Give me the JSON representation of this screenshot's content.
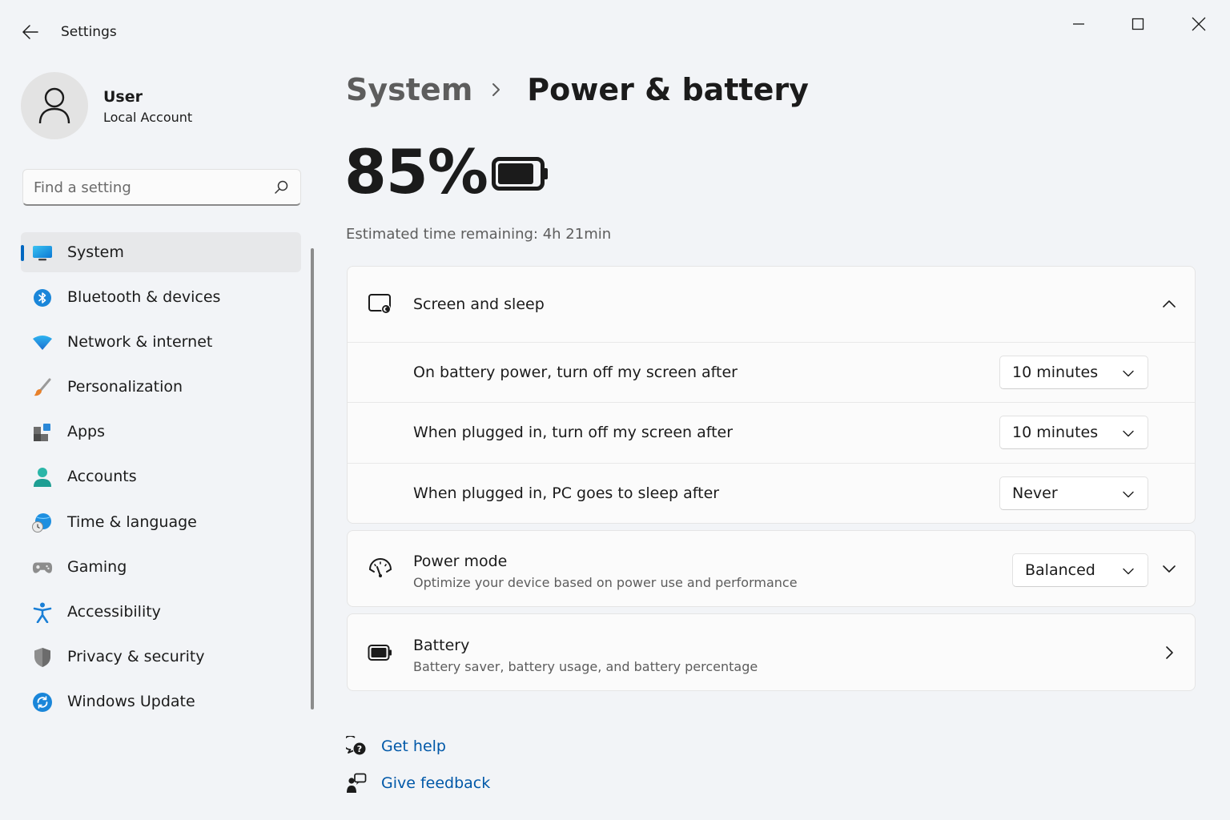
{
  "window": {
    "title": "Settings"
  },
  "user": {
    "name": "User",
    "account_type": "Local Account"
  },
  "search": {
    "placeholder": "Find a setting"
  },
  "sidebar": {
    "items": [
      {
        "label": "System",
        "icon": "system-display-icon",
        "active": true
      },
      {
        "label": "Bluetooth & devices",
        "icon": "bluetooth-icon"
      },
      {
        "label": "Network & internet",
        "icon": "wifi-icon"
      },
      {
        "label": "Personalization",
        "icon": "paintbrush-icon"
      },
      {
        "label": "Apps",
        "icon": "apps-icon"
      },
      {
        "label": "Accounts",
        "icon": "person-icon"
      },
      {
        "label": "Time & language",
        "icon": "globe-clock-icon"
      },
      {
        "label": "Gaming",
        "icon": "gamepad-icon"
      },
      {
        "label": "Accessibility",
        "icon": "accessibility-icon"
      },
      {
        "label": "Privacy & security",
        "icon": "shield-icon"
      },
      {
        "label": "Windows Update",
        "icon": "update-icon"
      }
    ]
  },
  "breadcrumb": {
    "parent": "System",
    "current": "Power & battery"
  },
  "battery": {
    "percent_text": "85%",
    "level": 0.85,
    "estimate": "Estimated time remaining: 4h 21min"
  },
  "screen_sleep": {
    "title": "Screen and sleep",
    "expanded": true,
    "rows": [
      {
        "label": "On battery power, turn off my screen after",
        "value": "10 minutes"
      },
      {
        "label": "When plugged in, turn off my screen after",
        "value": "10 minutes"
      },
      {
        "label": "When plugged in, PC goes to sleep after",
        "value": "Never"
      }
    ]
  },
  "power_mode": {
    "title": "Power mode",
    "subtitle": "Optimize your device based on power use and performance",
    "value": "Balanced"
  },
  "battery_card": {
    "title": "Battery",
    "subtitle": "Battery saver, battery usage, and battery percentage"
  },
  "help": {
    "get_help": "Get help",
    "give_feedback": "Give feedback"
  },
  "colors": {
    "accent": "#0067c0",
    "link": "#0058a8",
    "background": "#f2f4f7",
    "card": "#fbfbfb"
  }
}
